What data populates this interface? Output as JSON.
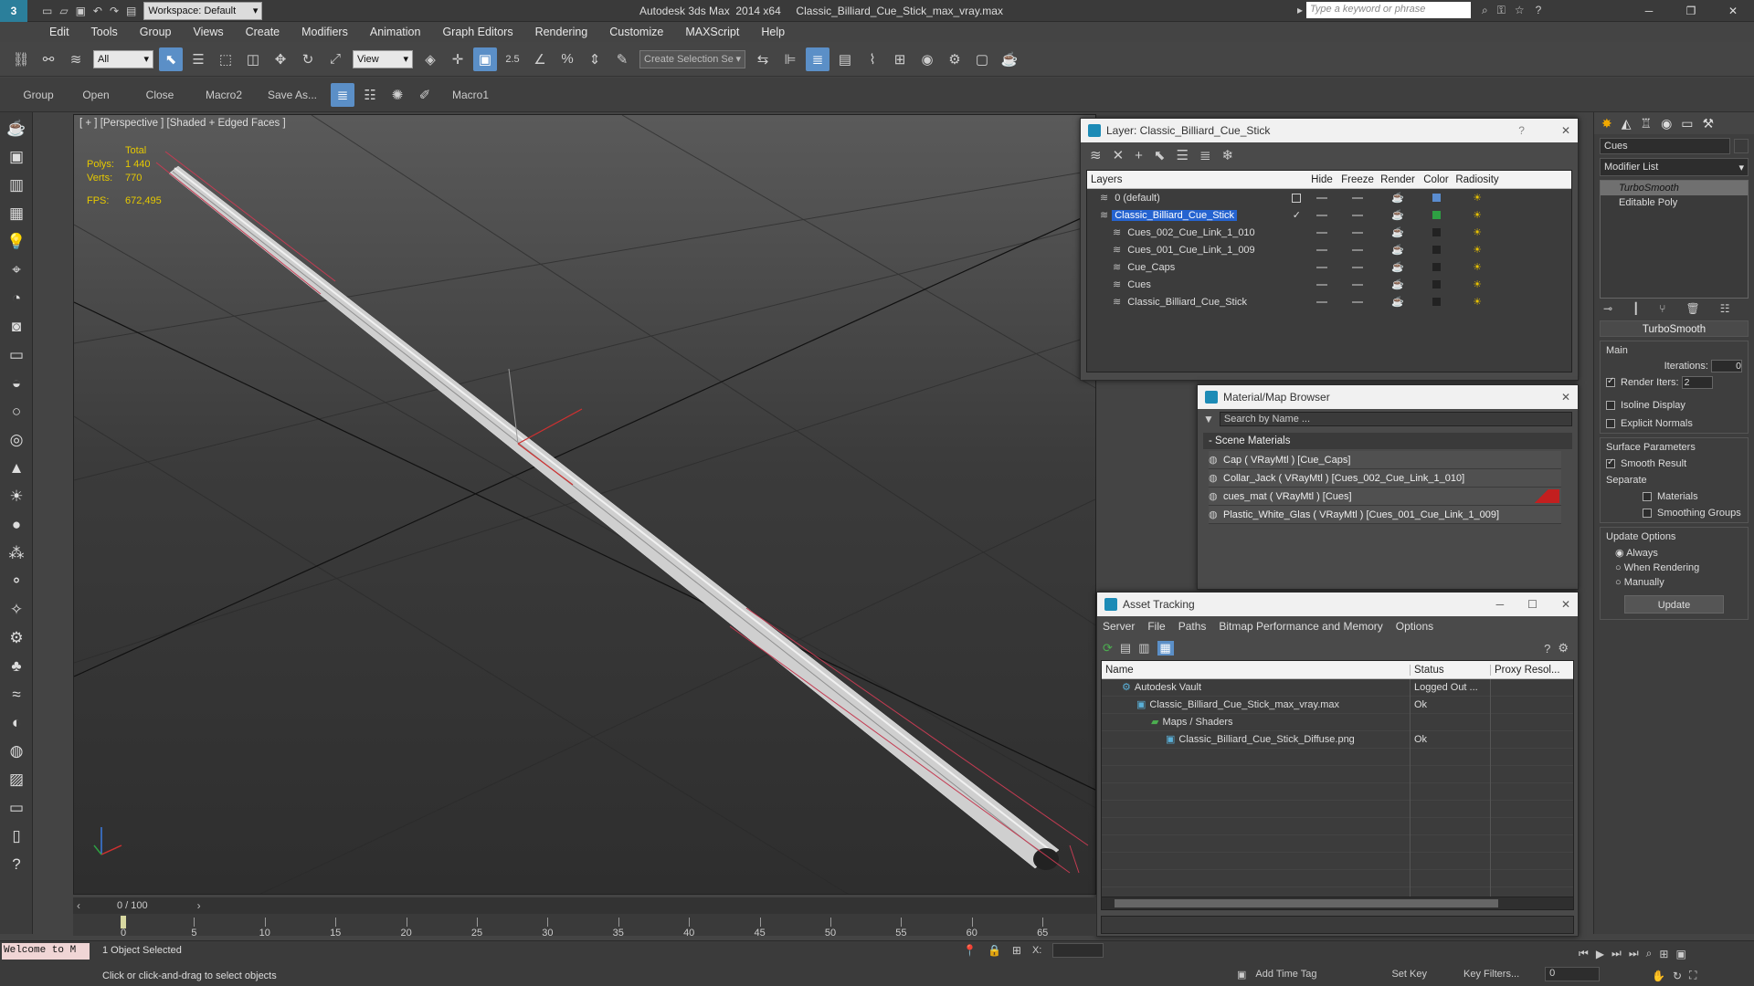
{
  "app": {
    "title": "Autodesk 3ds Max  2014 x64     Classic_Billiard_Cue_Stick_max_vray.max",
    "workspace": "Workspace: Default",
    "search_placeholder": "Type a keyword or phrase"
  },
  "menu": [
    "Edit",
    "Tools",
    "Group",
    "Views",
    "Create",
    "Modifiers",
    "Animation",
    "Graph Editors",
    "Rendering",
    "Customize",
    "MAXScript",
    "Help"
  ],
  "toolbar": {
    "selection_filter": "All",
    "ref_coord": "View",
    "snap_value": "2.5",
    "selection_set": "Create Selection Se"
  },
  "shelf": [
    "Group",
    "Open",
    "Close",
    "Macro2",
    "Save As...",
    "Macro1"
  ],
  "viewport": {
    "label": "[ + ] [Perspective ] [Shaded + Edged Faces ]",
    "stats_total": "Total",
    "polys_label": "Polys:",
    "polys_value": "1 440",
    "verts_label": "Verts:",
    "verts_value": "770",
    "fps_label": "FPS:",
    "fps_value": "672,495"
  },
  "layer_dialog": {
    "title": "Layer: Classic_Billiard_Cue_Stick",
    "columns": [
      "Layers",
      "Hide",
      "Freeze",
      "Render",
      "Color",
      "Radiosity"
    ],
    "rows": [
      {
        "name": "0 (default)",
        "indent": 0,
        "color": "#5a8ccf",
        "selected": false
      },
      {
        "name": "Classic_Billiard_Cue_Stick",
        "indent": 0,
        "color": "#2ea043",
        "selected": true
      },
      {
        "name": "Cues_002_Cue_Link_1_010",
        "indent": 1,
        "color": "#222222",
        "selected": false
      },
      {
        "name": "Cues_001_Cue_Link_1_009",
        "indent": 1,
        "color": "#222222",
        "selected": false
      },
      {
        "name": "Cue_Caps",
        "indent": 1,
        "color": "#222222",
        "selected": false
      },
      {
        "name": "Cues",
        "indent": 1,
        "color": "#222222",
        "selected": false
      },
      {
        "name": "Classic_Billiard_Cue_Stick",
        "indent": 1,
        "color": "#222222",
        "selected": false
      }
    ]
  },
  "material_browser": {
    "title": "Material/Map Browser",
    "search_placeholder": "Search by Name ...",
    "section": "- Scene Materials",
    "items": [
      {
        "label": "Cap  ( VRayMtl ) [Cue_Caps]",
        "highlight": false
      },
      {
        "label": "Collar_Jack  ( VRayMtl ) [Cues_002_Cue_Link_1_010]",
        "highlight": false
      },
      {
        "label": "cues_mat  ( VRayMtl ) [Cues]",
        "highlight": true
      },
      {
        "label": "Plastic_White_Glas  ( VRayMtl ) [Cues_001_Cue_Link_1_009]",
        "highlight": false
      }
    ]
  },
  "asset_tracking": {
    "title": "Asset Tracking",
    "menu": [
      "Server",
      "File",
      "Paths",
      "Bitmap Performance and Memory",
      "Options"
    ],
    "columns": [
      "Name",
      "Status",
      "Proxy Resol..."
    ],
    "rows": [
      {
        "name": "Autodesk Vault",
        "status": "Logged Out ...",
        "indent": 1
      },
      {
        "name": "Classic_Billiard_Cue_Stick_max_vray.max",
        "status": "Ok",
        "indent": 2
      },
      {
        "name": "Maps / Shaders",
        "status": "",
        "indent": 3
      },
      {
        "name": "Classic_Billiard_Cue_Stick_Diffuse.png",
        "status": "Ok",
        "indent": 4
      }
    ]
  },
  "command_panel": {
    "object_name": "Cues",
    "modifier_list": "Modifier List",
    "stack": [
      "TurboSmooth",
      "Editable Poly"
    ],
    "rollout_title": "TurboSmooth",
    "main_label": "Main",
    "iterations_label": "Iterations:",
    "iterations_value": "0",
    "render_iters_label": "Render Iters:",
    "render_iters_value": "2",
    "isoline": "Isoline Display",
    "explicit_normals": "Explicit Normals",
    "surface_params": "Surface Parameters",
    "smooth_result": "Smooth Result",
    "separate": "Separate",
    "materials": "Materials",
    "smoothing_groups": "Smoothing Groups",
    "update_options": "Update Options",
    "always": "Always",
    "when_rendering": "When Rendering",
    "manually": "Manually",
    "update_btn": "Update"
  },
  "timeline": {
    "frame_display": "0 / 100",
    "ticks": [
      "0",
      "5",
      "10",
      "15",
      "20",
      "25",
      "30",
      "35",
      "40",
      "45",
      "50",
      "55",
      "60",
      "65"
    ]
  },
  "status": {
    "welcome": "Welcome to M",
    "selected": "1 Object Selected",
    "hint": "Click or click-and-drag to select objects",
    "x_label": "X:",
    "add_time_tag": "Add Time Tag",
    "set_key": "Set Key",
    "key_filters": "Key Filters...",
    "frame": "0"
  }
}
